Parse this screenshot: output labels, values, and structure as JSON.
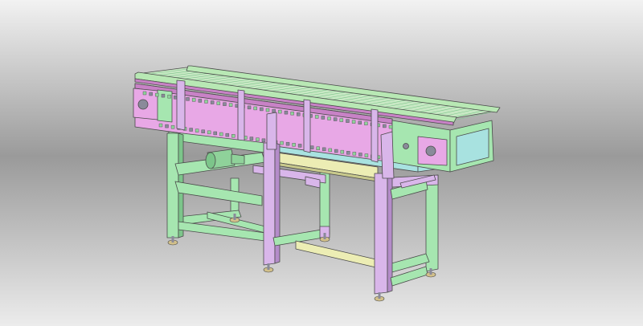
{
  "scene": {
    "subject": "chain-conveyor-3d-model",
    "background": {
      "top": "#f2f2f2",
      "middle": "#9a9a9a",
      "bottom": "#ececec"
    },
    "colors": {
      "frame_green": "#a6e6b0",
      "frame_green_dark": "#7cc58a",
      "leg_purple": "#d9b6ea",
      "leg_purple_dark": "#b48cc9",
      "side_pink": "#e8a8e6",
      "side_pink_dark": "#c882c6",
      "rail_green": "#b8e8b4",
      "chain_slat": "#c8e8c4",
      "brace_yellow": "#ecedb4",
      "brace_yellow_dark": "#c8c98c",
      "cyan_rail": "#a8e2e0",
      "motor_green": "#8fd29a",
      "bearing_gray": "#8a8a9a",
      "foot_tan": "#d2c08a",
      "edge": "#4a4a4a"
    }
  }
}
